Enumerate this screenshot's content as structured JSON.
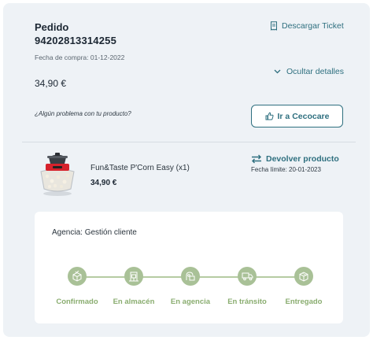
{
  "order": {
    "title": "Pedido",
    "number": "94202813314255",
    "purchase_date": "Fecha de compra: 01-12-2022",
    "total": "34,90 €",
    "problem_text": "¿Algún problema con tu producto?"
  },
  "actions": {
    "download_ticket": "Descargar Ticket",
    "hide_details": "Ocultar detalles",
    "cecocare_button": "Ir a Cecocare"
  },
  "product": {
    "name": "Fun&Taste P'Corn Easy (x1)",
    "price": "34,90 €",
    "return_label": "Devolver producto",
    "return_deadline": "Fecha límite: 20-01-2023"
  },
  "tracking": {
    "agency": "Agencia: Gestión cliente",
    "steps": [
      {
        "label": "Confirmado",
        "icon": "box-check-icon"
      },
      {
        "label": "En almacén",
        "icon": "warehouse-icon"
      },
      {
        "label": "En agencia",
        "icon": "agency-icon"
      },
      {
        "label": "En tránsito",
        "icon": "truck-icon"
      },
      {
        "label": "Entregado",
        "icon": "delivered-box-icon"
      }
    ]
  },
  "colors": {
    "accent": "#2e6f7f",
    "step_green": "#a9c197",
    "step_text": "#8aad70",
    "background": "#eef2f6"
  }
}
